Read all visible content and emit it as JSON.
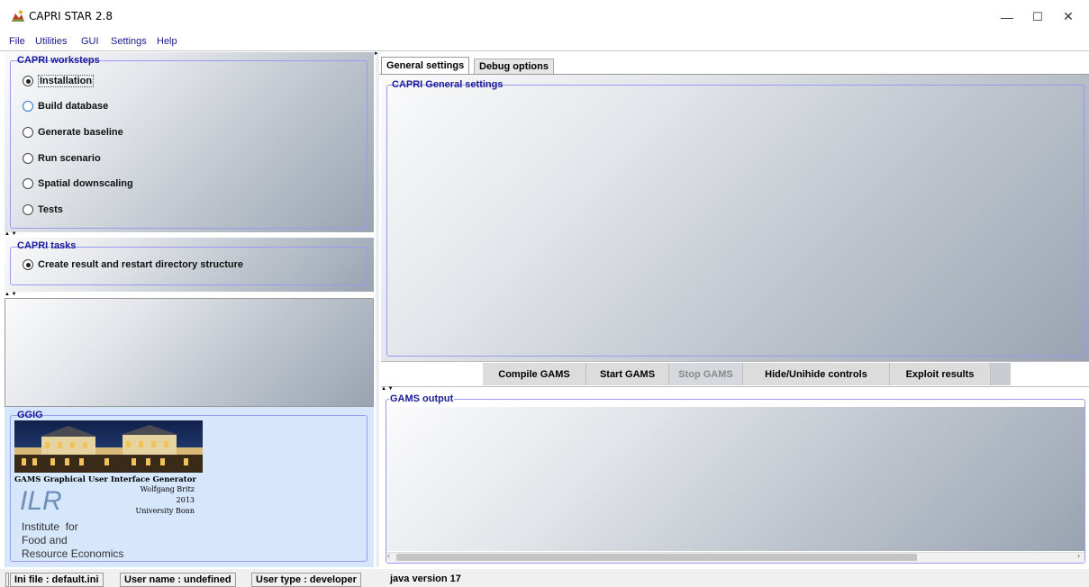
{
  "window": {
    "title": "CAPRI STAR 2.8",
    "minimize": "—",
    "maximize": "☐",
    "close": "✕"
  },
  "menu": [
    "File",
    "Utilities",
    "GUI",
    "Settings",
    "Help"
  ],
  "worksteps": {
    "title": "CAPRI worksteps",
    "items": [
      "Installation",
      "Build database",
      "Generate baseline",
      "Run scenario",
      "Spatial downscaling",
      "Tests"
    ],
    "selected": "Installation"
  },
  "tasks": {
    "title": "CAPRI tasks",
    "items": [
      "Create result and restart directory structure"
    ],
    "selected": "Create result and restart directory structure"
  },
  "ggig": {
    "title": "GGIG",
    "subtitle": "GAMS Graphical User Interface Generator",
    "author": "Wolfgang Britz",
    "year": "2013",
    "university": "University Bonn",
    "ilr": "ILR",
    "institute_lines": [
      "Institute  for",
      "Food and",
      "Resource Economics"
    ]
  },
  "tabs": [
    "General settings",
    "Debug options"
  ],
  "general_settings": {
    "title": "CAPRI General settings"
  },
  "buttons": {
    "compile": "Compile GAMS",
    "start": "Start GAMS",
    "stop": "Stop GAMS",
    "hide": "Hide/Unihide controls",
    "exploit": "Exploit results"
  },
  "gams_output": {
    "title": "GAMS output"
  },
  "status": {
    "ini": "Ini file : default.ini",
    "user": "User name : undefined",
    "type": "User type : developer",
    "java": "java version 17"
  }
}
